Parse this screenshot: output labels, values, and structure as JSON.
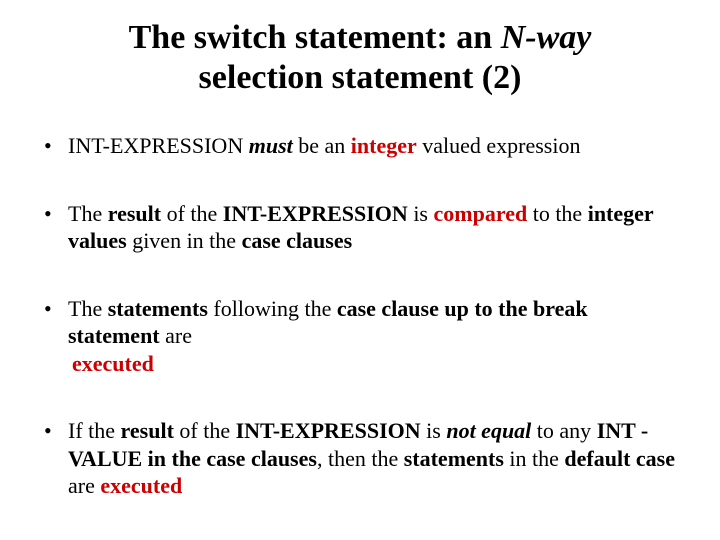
{
  "title": {
    "t1": "The switch statement: an ",
    "t2": "N-way",
    "t3": " selection statement (2)"
  },
  "b1": {
    "p1": " INT-EXPRESSION ",
    "p2": "must",
    "p3": " be an ",
    "p4": "integer",
    "p5": " valued expression"
  },
  "b2": {
    "p1": "The ",
    "p2": "result",
    "p3": " of the ",
    "p4": "INT-EXPRESSION",
    "p5": " is ",
    "p6": "compared",
    "p7": " to the ",
    "p8": "integer values",
    "p9": " given in the ",
    "p10": "case clauses"
  },
  "b3": {
    "p1": "The ",
    "p2": "statements",
    "p3": " following the ",
    "p4": "case clause up to the break statement",
    "p5": " are ",
    "p6": "executed"
  },
  "b4": {
    "p1": "If the ",
    "p2": "result",
    "p3": " of the ",
    "p4": "INT-EXPRESSION",
    "p5": " is ",
    "p6": "not equal",
    "p7": " to any ",
    "p8": "INT -VALUE in the case clauses",
    "p9": ", then the ",
    "p10": "statements",
    "p11": " in the ",
    "p12": "default case",
    "p13": " are ",
    "p14": "executed"
  }
}
